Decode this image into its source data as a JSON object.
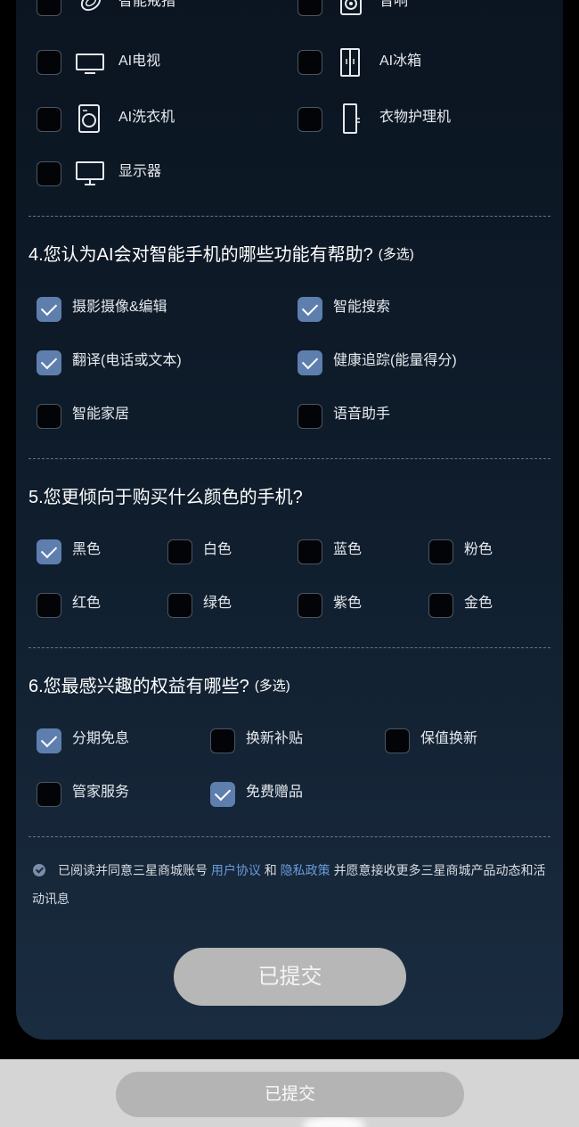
{
  "question3": {
    "options": [
      {
        "label": "智能戒指",
        "icon": "ring-icon",
        "checked": false
      },
      {
        "label": "音响",
        "icon": "speaker-icon",
        "checked": false
      },
      {
        "label": "AI电视",
        "icon": "tv-icon",
        "checked": false
      },
      {
        "label": "AI冰箱",
        "icon": "fridge-icon",
        "checked": false
      },
      {
        "label": "AI洗衣机",
        "icon": "washing-machine-icon",
        "checked": false
      },
      {
        "label": "衣物护理机",
        "icon": "clothing-care-icon",
        "checked": false
      },
      {
        "label": "显示器",
        "icon": "monitor-icon",
        "checked": false
      }
    ]
  },
  "question4": {
    "title": "4.您认为AI会对智能手机的哪些功能有帮助?",
    "multi": "(多选)",
    "options": [
      {
        "label": "摄影摄像&编辑",
        "checked": true
      },
      {
        "label": "智能搜索",
        "checked": true
      },
      {
        "label": "翻译(电话或文本)",
        "checked": true
      },
      {
        "label": "健康追踪(能量得分)",
        "checked": true
      },
      {
        "label": "智能家居",
        "checked": false
      },
      {
        "label": "语音助手",
        "checked": false
      }
    ]
  },
  "question5": {
    "title": "5.您更倾向于购买什么颜色的手机?",
    "options": [
      {
        "label": "黑色",
        "checked": true
      },
      {
        "label": "白色",
        "checked": false
      },
      {
        "label": "蓝色",
        "checked": false
      },
      {
        "label": "粉色",
        "checked": false
      },
      {
        "label": "红色",
        "checked": false
      },
      {
        "label": "绿色",
        "checked": false
      },
      {
        "label": "紫色",
        "checked": false
      },
      {
        "label": "金色",
        "checked": false
      }
    ]
  },
  "question6": {
    "title": "6.您最感兴趣的权益有哪些?",
    "multi": "(多选)",
    "options": [
      {
        "label": "分期免息",
        "checked": true
      },
      {
        "label": "换新补贴",
        "checked": false
      },
      {
        "label": "保值换新",
        "checked": false
      },
      {
        "label": "管家服务",
        "checked": false
      },
      {
        "label": "免费赠品",
        "checked": true
      }
    ]
  },
  "agreement": {
    "checked": true,
    "prefix": "已阅读并同意三星商城账号",
    "link1": "用户协议",
    "and": "和",
    "link2": "隐私政策",
    "suffix": "并愿意接收更多三星商城产品动态和活动讯息"
  },
  "submit": {
    "main_label": "已提交",
    "bottom_label": "已提交"
  },
  "colors": {
    "accent_check": "#5e7fae",
    "link": "#6a9bd8",
    "button": "#b7b7b7"
  }
}
